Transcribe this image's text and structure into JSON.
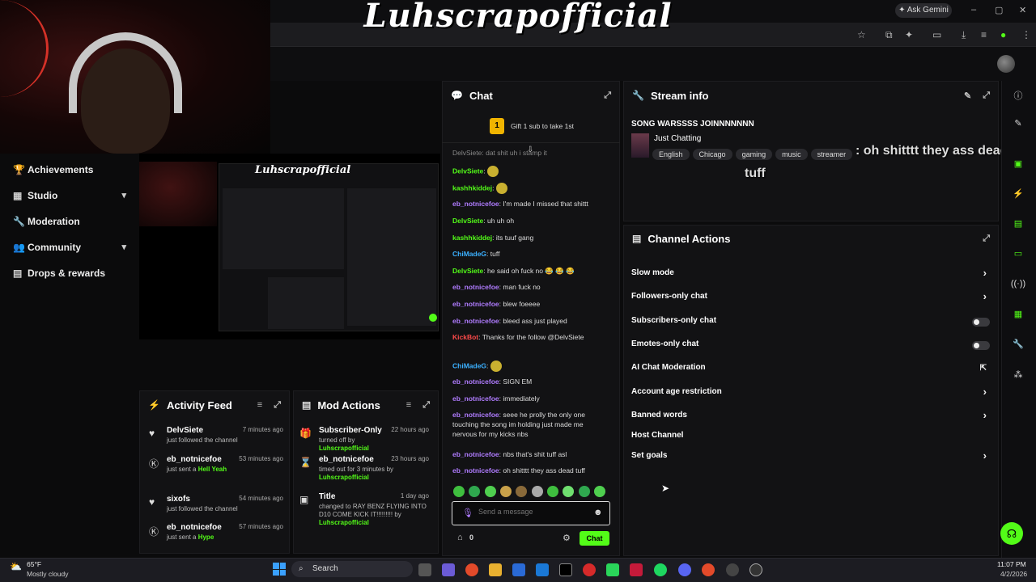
{
  "browser": {
    "title_overlay": "Luhscrapofficial",
    "ask_gemini": "Ask Gemini",
    "window_controls": [
      "–",
      "▢",
      "✕"
    ]
  },
  "nav": {
    "items": [
      {
        "label": "Achievements",
        "icon": "trophy-icon",
        "glyph": "🏆",
        "chevron": false
      },
      {
        "label": "Studio",
        "icon": "studio-icon",
        "glyph": "▦",
        "chevron": true
      },
      {
        "label": "Moderation",
        "icon": "wrench-icon",
        "glyph": "🔧",
        "chevron": false
      },
      {
        "label": "Community",
        "icon": "community-icon",
        "glyph": "👥",
        "chevron": true
      },
      {
        "label": "Drops & rewards",
        "icon": "drops-icon",
        "glyph": "▤",
        "chevron": false
      }
    ]
  },
  "preview": {
    "mini_title": "Luhscrapofficial"
  },
  "activity_feed": {
    "title": "Activity Feed",
    "items": [
      {
        "icon": "heart-icon",
        "glyph": "♥",
        "name": "DelvSiete",
        "time": "7 minutes ago",
        "text": "just followed the channel",
        "highlight": ""
      },
      {
        "icon": "kick-icon",
        "glyph": "Ⓚ",
        "name": "eb_notnicefoe",
        "time": "53 minutes ago",
        "text": "just sent a",
        "highlight": "Hell Yeah"
      },
      {
        "icon": "heart-icon",
        "glyph": "♥",
        "name": "sixofs",
        "time": "54 minutes ago",
        "text": "just followed the channel",
        "highlight": ""
      },
      {
        "icon": "kick-icon",
        "glyph": "Ⓚ",
        "name": "eb_notnicefoe",
        "time": "57 minutes ago",
        "text": "just sent a",
        "highlight": "Hype"
      }
    ]
  },
  "mod_actions": {
    "title": "Mod Actions",
    "items": [
      {
        "icon": "gift-icon",
        "glyph": "🎁",
        "name": "Subscriber-Only",
        "time": "22 hours ago",
        "text": "turned off by",
        "by": "Luhscrapofficial"
      },
      {
        "icon": "hourglass-icon",
        "glyph": "⌛",
        "name": "eb_notnicefoe",
        "time": "23 hours ago",
        "text": "timed out for 3 minutes by",
        "by": "Luhscrapofficial"
      },
      {
        "icon": "title-icon",
        "glyph": "▣",
        "name": "Title",
        "time": "1 day ago",
        "text": "changed to RAY BENZ FLYING INTO D10 COME KICK IT!!!!!!!!! by",
        "by": "Luhscrapofficial"
      }
    ]
  },
  "chat": {
    "title": "Chat",
    "gift_banner": "Gift 1 sub to take 1st",
    "partial_top": "DelvSiete: dat shit uh    i stamp it",
    "messages": [
      {
        "user": "DelvSiete",
        "color": "green",
        "text": ""
      },
      {
        "user": "kashhkiddej",
        "color": "green",
        "text": ""
      },
      {
        "user": "eb_notnicefoe",
        "color": "purple",
        "text": "I'm made I missed that shittt"
      },
      {
        "user": "DelvSiete",
        "color": "green",
        "text": "uh uh oh"
      },
      {
        "user": "kashhkiddej",
        "color": "green",
        "text": "its tuuf gang"
      },
      {
        "user": "ChiMadeG",
        "color": "blue",
        "text": "tuff"
      },
      {
        "user": "DelvSiete",
        "color": "green",
        "text": "he said oh fuck no 😂 😂 😂"
      },
      {
        "user": "eb_notnicefoe",
        "color": "purple",
        "text": "man fuck no"
      },
      {
        "user": "eb_notnicefoe",
        "color": "purple",
        "text": "blew foeeee"
      },
      {
        "user": "eb_notnicefoe",
        "color": "purple",
        "text": "bleed ass just played"
      },
      {
        "user": "KickBot",
        "color": "red",
        "text": "Thanks for the follow @DelvSiete"
      },
      {
        "user": "ChiMadeG",
        "color": "blue",
        "text": ""
      },
      {
        "user": "eb_notnicefoe",
        "color": "purple",
        "text": "SIGN EM"
      },
      {
        "user": "eb_notnicefoe",
        "color": "purple",
        "text": "immediately"
      },
      {
        "user": "eb_notnicefoe",
        "color": "purple",
        "text": "seee he prolly the only one touching the song im holding just made me nervous for my kicks nbs"
      },
      {
        "user": "eb_notnicefoe",
        "color": "purple",
        "text": "nbs that's shit tuff asl"
      },
      {
        "user": "eb_notnicefoe",
        "color": "purple",
        "text": "oh shitttt they ass dead tuff"
      }
    ],
    "input_placeholder": "Send a message",
    "points": "0",
    "send_label": "Chat"
  },
  "stream_info": {
    "title": "Stream info",
    "stream_title": "SONG WARSSSS JOINNNNNNN",
    "category": "Just Chatting",
    "tags": [
      "English",
      "Chicago",
      "gaming",
      "music",
      "streamer"
    ],
    "overlay_line1": ": oh shitttt they ass dead",
    "overlay_line2": "tuff"
  },
  "channel_actions": {
    "title": "Channel Actions",
    "rows": [
      {
        "label": "Slow mode",
        "control": "arrow"
      },
      {
        "label": "Followers-only chat",
        "control": "arrow"
      },
      {
        "label": "Subscribers-only chat",
        "control": "toggle"
      },
      {
        "label": "Emotes-only chat",
        "control": "toggle"
      },
      {
        "label": "AI Chat Moderation",
        "control": "external"
      },
      {
        "label": "Account age restriction",
        "control": "arrow"
      },
      {
        "label": "Banned words",
        "control": "arrow"
      },
      {
        "label": "Host Channel",
        "control": "none"
      },
      {
        "label": "Set goals",
        "control": "arrow"
      }
    ]
  },
  "taskbar": {
    "weather_temp": "65°F",
    "weather_desc": "Mostly cloudy",
    "search": "Search",
    "time": "11:07 PM",
    "date": "4/2/2026"
  },
  "colors": {
    "accent": "#53fc18",
    "panel": "#121214",
    "bg": "#0b0b0c"
  }
}
